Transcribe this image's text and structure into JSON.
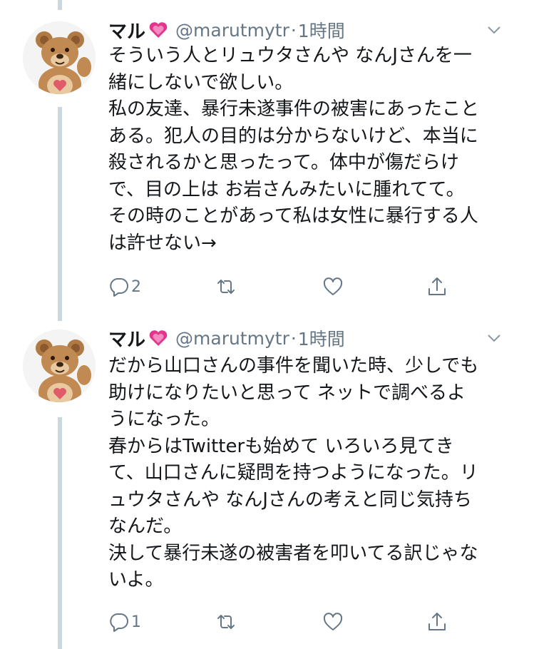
{
  "tweets": [
    {
      "name": "マル",
      "handle": "@marutmytr",
      "separator": "·",
      "time": "1時間",
      "text": "そういう人とリュウタさんや なんJさんを一\n緒にしないで欲しい。\n私の友達、暴行未遂事件の被害にあったこと\nある。犯人の目的は分からないけど、本当に\n殺されるかと思ったって。体中が傷だらけ\nで、目の上は お岩さんみたいに腫れてて。\nその時のことがあって私は女性に暴行する人\nは許せない→",
      "reply_count": "2",
      "retweet_count": "",
      "like_count": ""
    },
    {
      "name": "マル",
      "handle": "@marutmytr",
      "separator": "·",
      "time": "1時間",
      "text": "だから山口さんの事件を聞いた時、少しでも\n助けになりたいと思って ネットで調べるよ\nうになった。\n春からはTwitterも始めて いろいろ見てき\nて、山口さんに疑問を持つようになった。リ\nュウタさんや なんJさんの考えと同じ気持ち\nなんだ。\n決して暴行未遂の被害者を叩いてる訳じゃな\nいよ。",
      "reply_count": "1",
      "retweet_count": "",
      "like_count": ""
    }
  ],
  "icons": {
    "reply": "reply-icon",
    "retweet": "retweet-icon",
    "like": "like-icon",
    "share": "share-icon",
    "caret": "chevron-down-icon",
    "emoji": "sparkling-heart-icon",
    "avatar": "teddy-bear-avatar"
  },
  "colors": {
    "text": "#14171a",
    "secondary": "#657786",
    "thread_line": "#ccd6dd",
    "heart": "#e0368c"
  }
}
